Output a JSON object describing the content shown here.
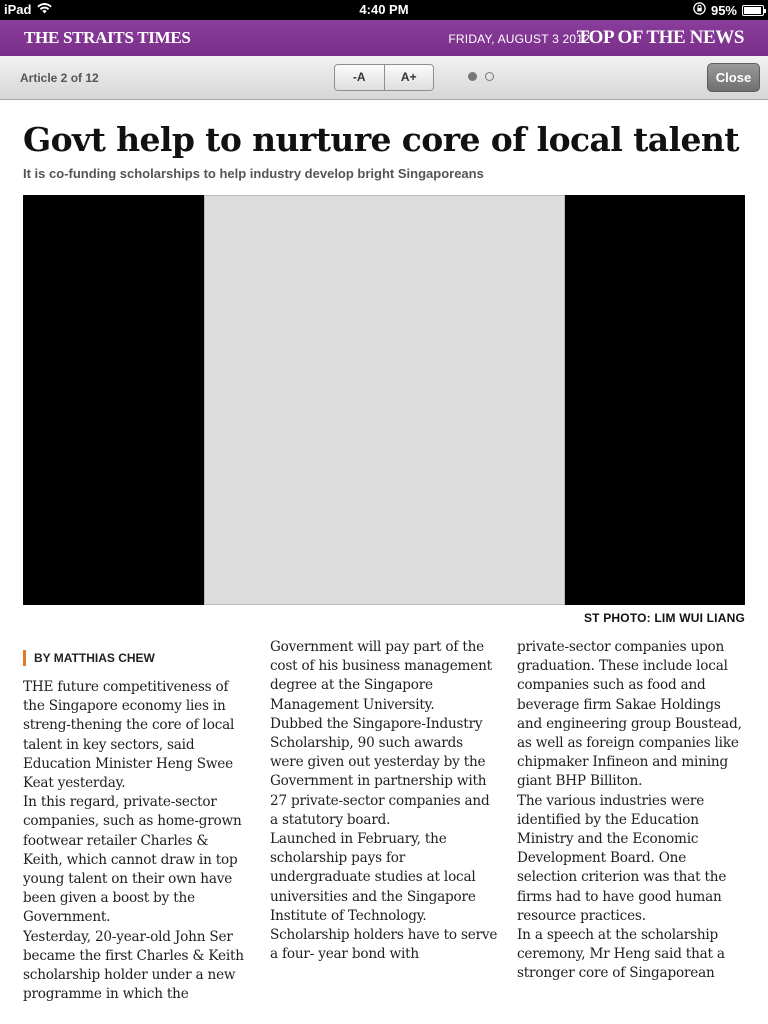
{
  "status_bar": {
    "device": "iPad",
    "time": "4:40 PM",
    "battery": "95%",
    "battery_level": 0.95
  },
  "masthead": {
    "brand": "THE STRAITS TIMES",
    "date": "FRIDAY, AUGUST 3 2012",
    "section": "TOP OF THE NEWS",
    "color": "#7e3290"
  },
  "toolbar": {
    "counter": "Article 2 of 12",
    "font_smaller": "-A",
    "font_larger": "A+",
    "close": "Close",
    "page_dots": 2,
    "active_dot": 1
  },
  "article": {
    "headline": "Govt help to nurture core of local talent",
    "subhead": "It is co-funding scholarships to help industry develop bright Singaporeans",
    "photo_credit": "ST PHOTO: LIM WUI LIANG",
    "byline": "BY MATTHIAS CHEW",
    "columns": [
      "THE future competitiveness of the Singapore economy lies in streng-thening the core of local talent in key sectors, said Education Minister Heng Swee Keat yesterday.\n In this regard, private-sector companies, such as home-grown footwear retailer Charles & Keith, which cannot draw in top young talent on their own have been given a boost by the Government.\n Yesterday, 20-year-old John Ser became the first Charles & Keith scholarship holder under a new programme in which the",
      "Government will pay part of the cost of his business management degree at the Singapore Management University.\n Dubbed the Singapore-Industry Scholarship, 90 such awards were given out yesterday by the Government in partnership with 27 private-sector companies and a statutory board.\n Launched in February, the scholarship pays for undergraduate studies at local universities and the Singapore Institute of Technology.\n Scholarship holders have to serve a four- year bond with",
      "private-sector companies upon graduation. These include local companies such as food and beverage firm Sakae Holdings and engineering group Boustead, as well as foreign companies like chipmaker Infineon and mining giant BHP Billiton.\n The various industries were identified by the Education Ministry and the Economic Development Board. One selection criterion was that the firms had to have good human resource practices.\n In a speech at the scholarship ceremony, Mr Heng said that a stronger core of Singaporean"
    ]
  }
}
